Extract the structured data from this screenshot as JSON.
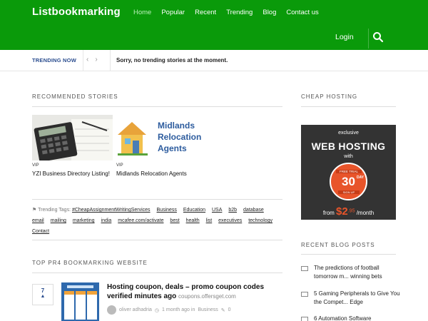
{
  "header": {
    "logo": "Listbookmarking",
    "nav": [
      "Home",
      "Popular",
      "Recent",
      "Trending",
      "Blog",
      "Contact us"
    ],
    "login": "Login",
    "search_icon": "search-icon",
    "bg_color": "#0a9a0a"
  },
  "trending": {
    "label": "TRENDING NOW",
    "prev": "‹",
    "next": "›",
    "message": "Sorry, no trending stories at the moment."
  },
  "recommended": {
    "title": "RECOMMENDED STORIES",
    "stories": [
      {
        "tag": "VIP",
        "title": "YZI Business Directory Listing!"
      },
      {
        "tag": "VIP",
        "title": "Midlands Relocation Agents",
        "image_text": "Midlands Relocation Agents"
      }
    ]
  },
  "tags": {
    "label": "Trending Tags:",
    "items": [
      "#CheapAssignmentWritingServices",
      "Business",
      "Education",
      "USA",
      "b2b",
      "database",
      "email",
      "mailing",
      "marketing",
      "india",
      "mcafee.com/activate",
      "best",
      "health",
      "list",
      "executives",
      "technology",
      "Contact"
    ]
  },
  "top_pr4": {
    "title": "TOP PR4 BOOKMARKING WEBSITE",
    "post": {
      "votes": "7",
      "title": "Hosting coupon, deals – promo coupon codes verified minutes ago",
      "domain": "coupons.offersget.com",
      "author": "oliver adhadria",
      "time": "1 month ago in",
      "category": "Business",
      "comments": "0"
    }
  },
  "sidebar": {
    "cheap_hosting_title": "CHEAP HOSTING",
    "ad": {
      "exclusive": "exclusive",
      "headline": "WEB HOSTING",
      "with": "with",
      "trial": "FREE TRIAL",
      "days": "30",
      "day_label": "DAY",
      "sign": "SIGN UP",
      "from": "from",
      "price": "$2",
      "cents": ".95",
      "per": "/month"
    },
    "recent_title": "RECENT BLOG POSTS",
    "recent_posts": [
      "The predictions of football tomorrow m... winning bets",
      "5 Gaming Peripherals to Give You the Compet... Edge",
      "6 Automation Software"
    ]
  }
}
